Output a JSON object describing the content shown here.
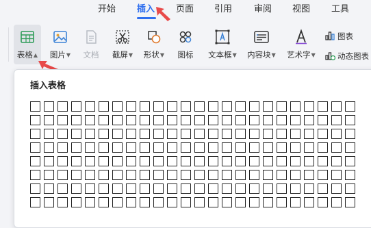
{
  "menu": {
    "tabs": [
      {
        "label": "开始"
      },
      {
        "label": "插入"
      },
      {
        "label": "页面"
      },
      {
        "label": "引用"
      },
      {
        "label": "审阅"
      },
      {
        "label": "视图"
      },
      {
        "label": "工具"
      }
    ],
    "active_tab": "插入"
  },
  "ribbon": {
    "table": {
      "label": "表格",
      "icon": "table-icon"
    },
    "picture": {
      "label": "图片",
      "icon": "picture-icon"
    },
    "text": {
      "label": "文档",
      "icon": "document-icon"
    },
    "screenshot": {
      "label": "截屏",
      "icon": "scissors-icon"
    },
    "shapes": {
      "label": "形状",
      "icon": "shapes-icon"
    },
    "icons": {
      "label": "图标",
      "icon": "icons-icon"
    },
    "textbox": {
      "label": "文本框",
      "icon": "textbox-icon"
    },
    "content_block": {
      "label": "内容块",
      "icon": "content-block-icon"
    },
    "wordart": {
      "label": "艺术字",
      "icon": "wordart-icon"
    },
    "chart": {
      "label": "图表",
      "icon": "chart-icon"
    },
    "dynamic_chart": {
      "label": "动态图表",
      "icon": "dynamic-chart-icon"
    }
  },
  "panel": {
    "title": "插入表格",
    "grid_columns": 24,
    "grid_rows": 8
  },
  "colors": {
    "accent": "#2f6fef",
    "annotation_arrow": "#e84a4a"
  }
}
